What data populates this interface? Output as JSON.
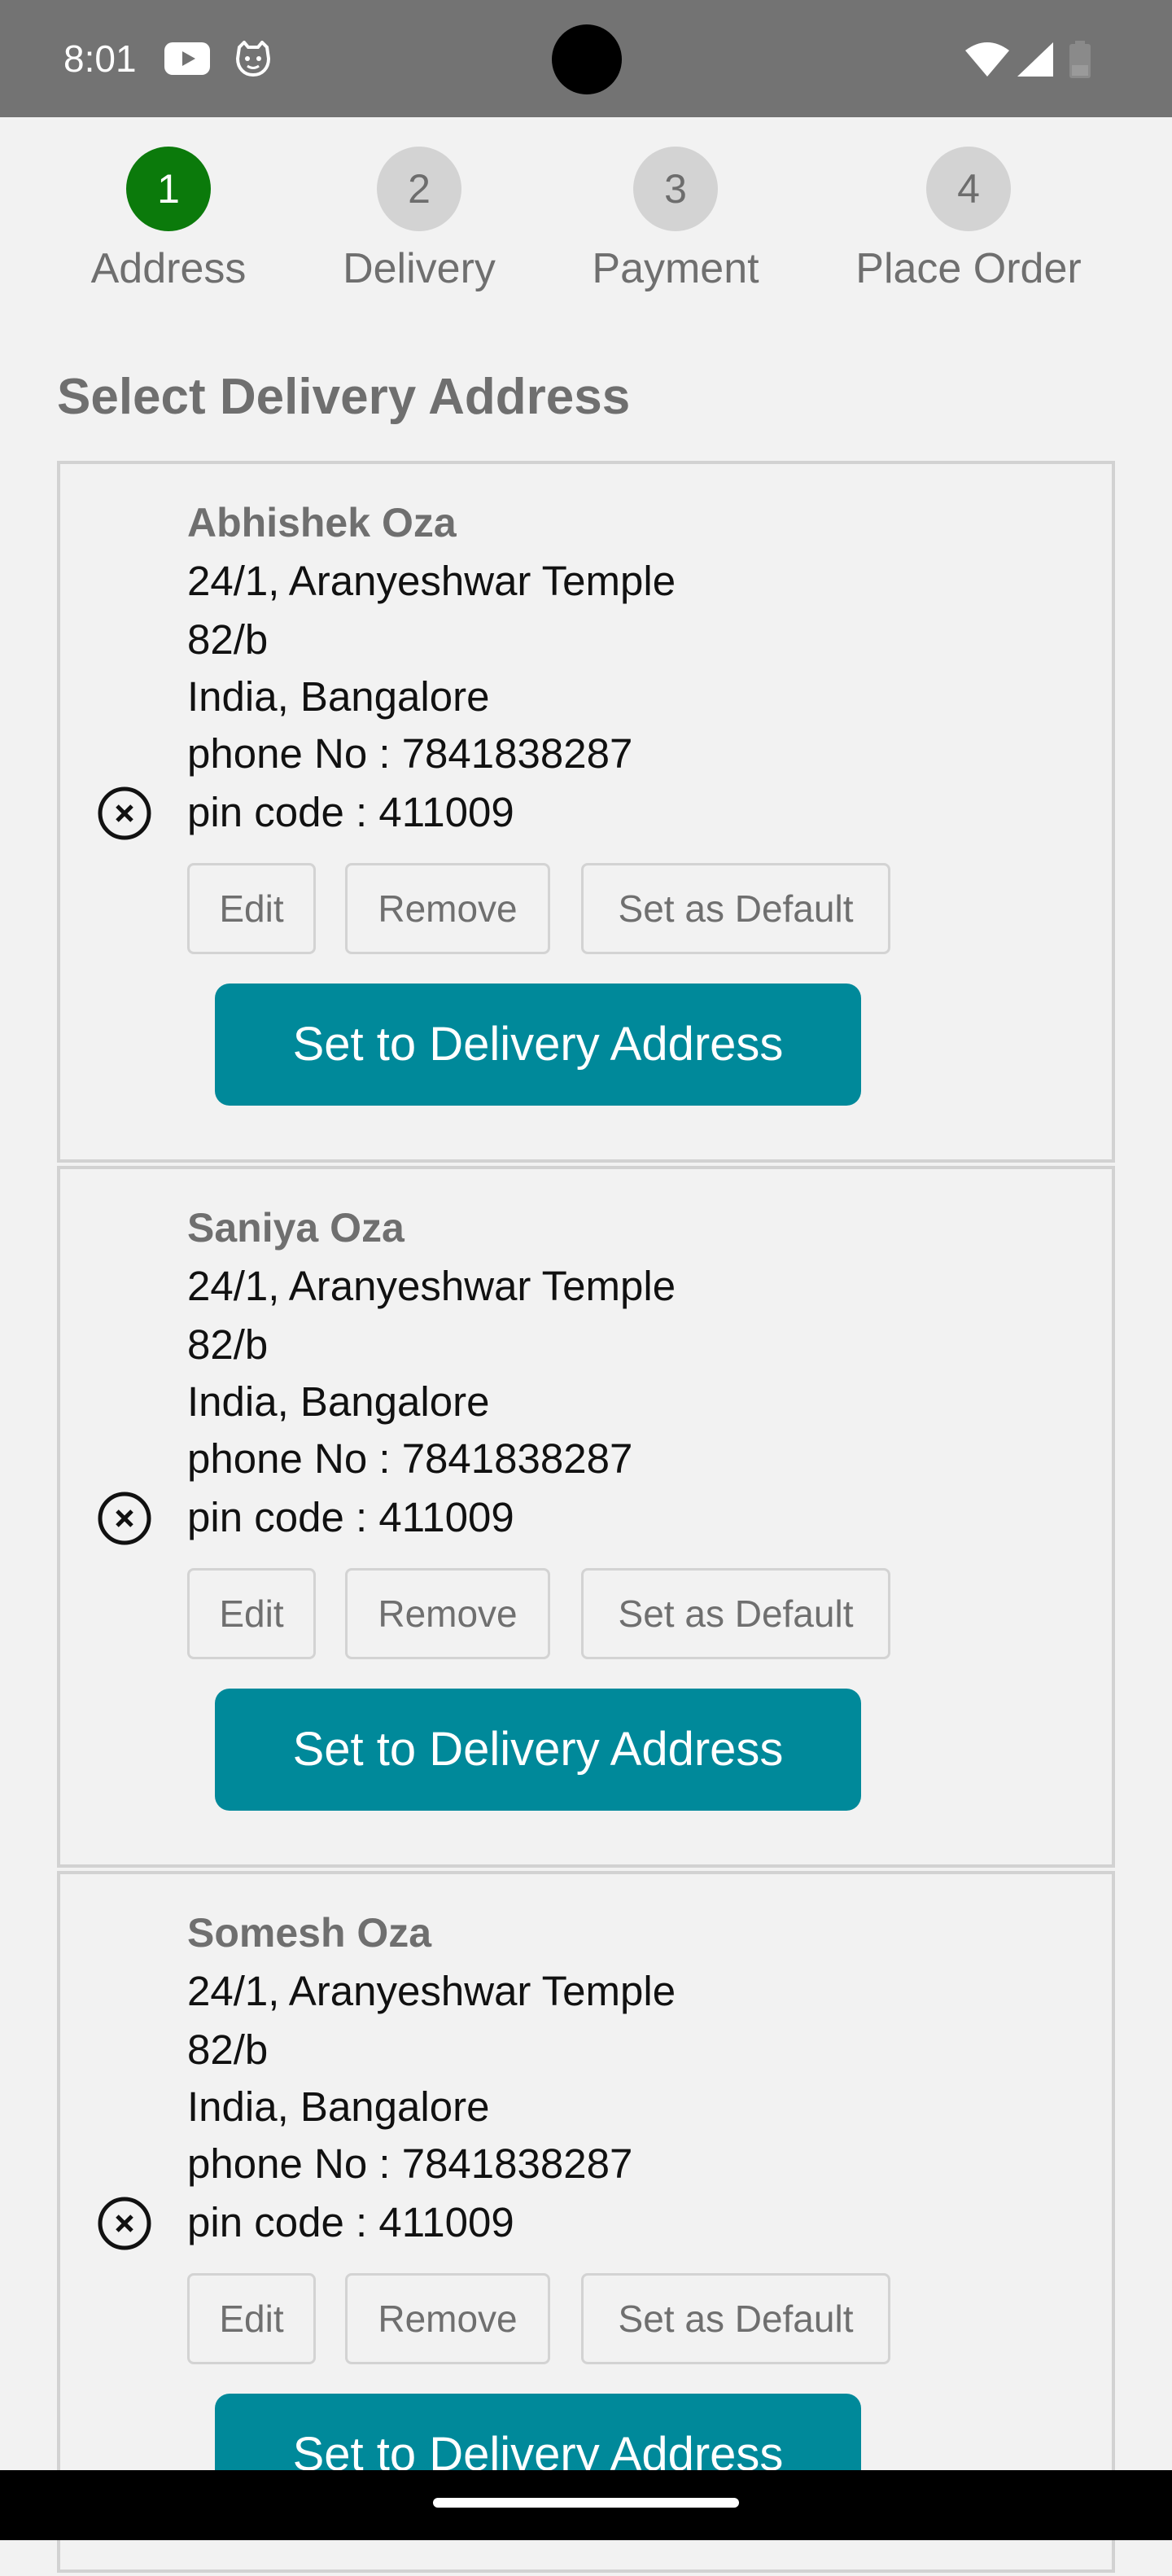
{
  "status_bar": {
    "time": "8:01",
    "icons": [
      "youtube-icon",
      "cat-icon",
      "wifi-icon",
      "signal-icon",
      "battery-icon"
    ],
    "background": "#737373"
  },
  "stepper": {
    "steps": [
      {
        "number": "1",
        "label": "Address",
        "active": true
      },
      {
        "number": "2",
        "label": "Delivery",
        "active": false
      },
      {
        "number": "3",
        "label": "Payment",
        "active": false
      },
      {
        "number": "4",
        "label": "Place Order",
        "active": false
      }
    ],
    "active_color": "#0b7a0b",
    "inactive_color": "#d3d3d3"
  },
  "page_title": "Select Delivery Address",
  "addresses": [
    {
      "name": "Abhishek Oza",
      "line1": "24/1, Aranyeshwar Temple",
      "line2": "82/b",
      "line3": "India, Bangalore",
      "phone": "phone No : 7841838287",
      "pin": "pin code : 411009"
    },
    {
      "name": "Saniya Oza",
      "line1": "24/1, Aranyeshwar Temple",
      "line2": "82/b",
      "line3": "India, Bangalore",
      "phone": "phone No : 7841838287",
      "pin": "pin code : 411009"
    },
    {
      "name": "Somesh Oza",
      "line1": "24/1, Aranyeshwar Temple",
      "line2": "82/b",
      "line3": "India, Bangalore",
      "phone": "phone No : 7841838287",
      "pin": "pin code : 411009"
    }
  ],
  "buttons": {
    "edit": "Edit",
    "remove": "Remove",
    "set_default": "Set as Default",
    "set_delivery": "Set to Delivery Address"
  },
  "colors": {
    "primary": "#00899a",
    "title_gray": "#6f6f6f"
  }
}
